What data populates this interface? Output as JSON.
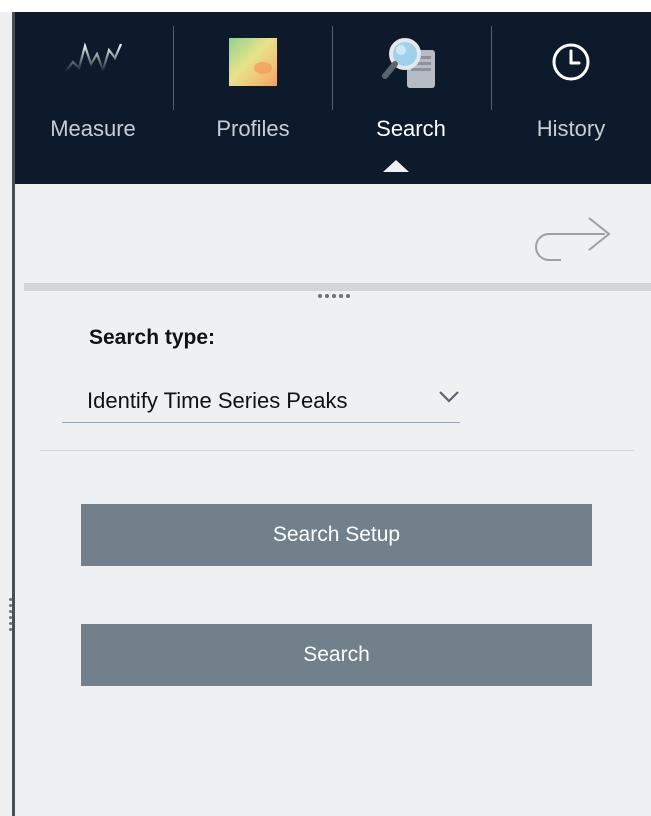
{
  "nav": {
    "tabs": [
      {
        "label": "Measure",
        "icon": "measure-chart-icon",
        "active": false
      },
      {
        "label": "Profiles",
        "icon": "profiles-heatmap-icon",
        "active": false
      },
      {
        "label": "Search",
        "icon": "search-magnifier-icon",
        "active": true
      },
      {
        "label": "History",
        "icon": "clock-icon",
        "active": false
      }
    ]
  },
  "toolbar": {
    "redo_icon": "redo-arrow-icon"
  },
  "search": {
    "type_label": "Search type:",
    "type_value": "Identify Time Series Peaks",
    "setup_label": "Search Setup",
    "search_label": "Search"
  },
  "colors": {
    "nav_bg": "#0c1a2c",
    "panel_bg": "#eff0f2",
    "button_bg": "#72808c"
  }
}
